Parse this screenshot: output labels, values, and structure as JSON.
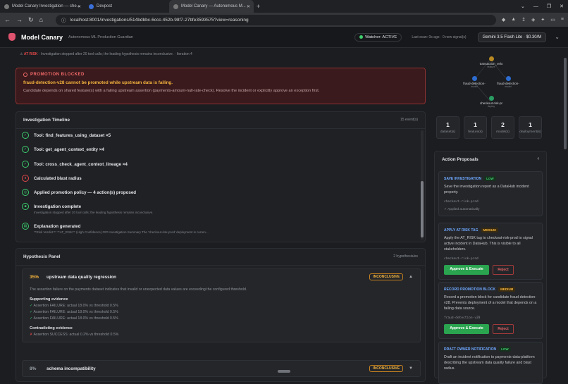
{
  "browser": {
    "tabs": [
      {
        "title": "Model Canary Investigation — che..."
      },
      {
        "title": "Devpost"
      },
      {
        "title": "Model Canary — Autonomous M..."
      }
    ],
    "url": "localhost:8001/investigations/514bdbbc-6ccc-452b-98f7-27bfe3593575?view=reasoning"
  },
  "app": {
    "name": "Model Canary",
    "tagline": "Autonomous ML Production Guardian",
    "watcher": "Watcher: ACTIVE",
    "last_scan": "Last scan: 0s ago · 0 new signal(s)",
    "model": "Gemini 3.5 Flash Lite · $0.30/M"
  },
  "risk_line": {
    "label": "AT RISK",
    "text": " · Investigation stopped after 20 tool calls; the leading hypothesis remains inconclusive. · Iteration 4"
  },
  "blocked": {
    "heading": "PROMOTION BLOCKED",
    "summary": "fraud-detection-v28 cannot be promoted while upstream data is failing.",
    "detail": "Candidate depends on shared feature(s) with a failing upstream assertion (payments-amount-null-rate-check). Resolve the incident or explicitly approve an exception first."
  },
  "timeline": {
    "title": "Investigation Timeline",
    "count": "15 event(s)",
    "events": [
      {
        "title": "Tool: find_features_using_dataset ×5",
        "sub": ""
      },
      {
        "title": "Tool: get_agent_context_entity ×4",
        "sub": ""
      },
      {
        "title": "Tool: cross_check_agent_context_lineage ×4",
        "sub": ""
      },
      {
        "title": "Calculated blast radius",
        "sub": ""
      },
      {
        "title": "Applied promotion policy — 4 action(s) proposed",
        "sub": ""
      },
      {
        "title": "Investigation complete",
        "sub": "Investigation stopped after 20 tool calls; the leading hypothesis remains inconclusive."
      },
      {
        "title": "Explanation generated",
        "sub": "**Risk Verdict:** **AT_RISK** (High Confidence) ### Investigation Summary The 'checkout-risk-prod' deployment is curren..."
      }
    ]
  },
  "hypotheses": {
    "title": "Hypothesis Panel",
    "count": "2 hypothesis/es",
    "items": [
      {
        "pct": "35%",
        "name": "upstream data quality regression",
        "status": "INCONCLUSIVE",
        "desc": "The assertion failure on the payments dataset indicates that invalid or unexpected data values are exceeding the configured threshold.",
        "support_label": "Supporting evidence",
        "support": [
          "Assertion FAILURE: actual 18.0% vs threshold 0.5%",
          "Assertion FAILURE: actual 18.0% vs threshold 0.5%",
          "Assertion FAILURE: actual 18.0% vs threshold 0.5%"
        ],
        "contra_label": "Contradicting evidence",
        "contra": [
          "Assertion SUCCESS: actual 0.2% vs threshold 0.5%"
        ]
      },
      {
        "pct": "8%",
        "name": "schema incompatibility",
        "status": "INCONCLUSIVE"
      }
    ]
  },
  "graph": {
    "nodes": [
      {
        "name": "transaction_velo",
        "type": "feature"
      },
      {
        "name": "fraud-detection-",
        "type": "model"
      },
      {
        "name": "fraud-detection-",
        "type": "model"
      },
      {
        "name": "checkout-risk-pr",
        "type": "deploy"
      }
    ]
  },
  "stats": [
    {
      "n": "1",
      "l": "dataset(s)"
    },
    {
      "n": "1",
      "l": "feature(s)"
    },
    {
      "n": "2",
      "l": "model(s)"
    },
    {
      "n": "1",
      "l": "deployment(s)"
    }
  ],
  "actions": {
    "title": "Action Proposals",
    "count": "4",
    "items": [
      {
        "title": "SAVE INVESTIGATION",
        "level": "LOW",
        "desc": "Save the investigation report as a DataHub incident property.",
        "code": "checkout-risk-prod",
        "applied": "✓ Applied automatically"
      },
      {
        "title": "APPLY AT RISK TAG",
        "level": "MEDIUM",
        "desc": "Apply the AT_RISK tag to checkout-risk-prod to signal active incident in DataHub. This is visible to all stakeholders.",
        "code": "checkout-risk-prod",
        "approve": "Approve & Execute",
        "reject": "Reject"
      },
      {
        "title": "RECORD PROMOTION BLOCK",
        "level": "MEDIUM",
        "desc": "Record a promotion block for candidate fraud-detection-v28. Prevents deployment of a model that depends on a failing data source.",
        "code": "fraud-detection-v28",
        "approve": "Approve & Execute",
        "reject": "Reject"
      },
      {
        "title": "DRAFT OWNER NOTIFICATION",
        "level": "LOW",
        "desc": "Draft an incident notification to payments-data-platform describing the upstream data quality failure and blast radius."
      }
    ]
  }
}
